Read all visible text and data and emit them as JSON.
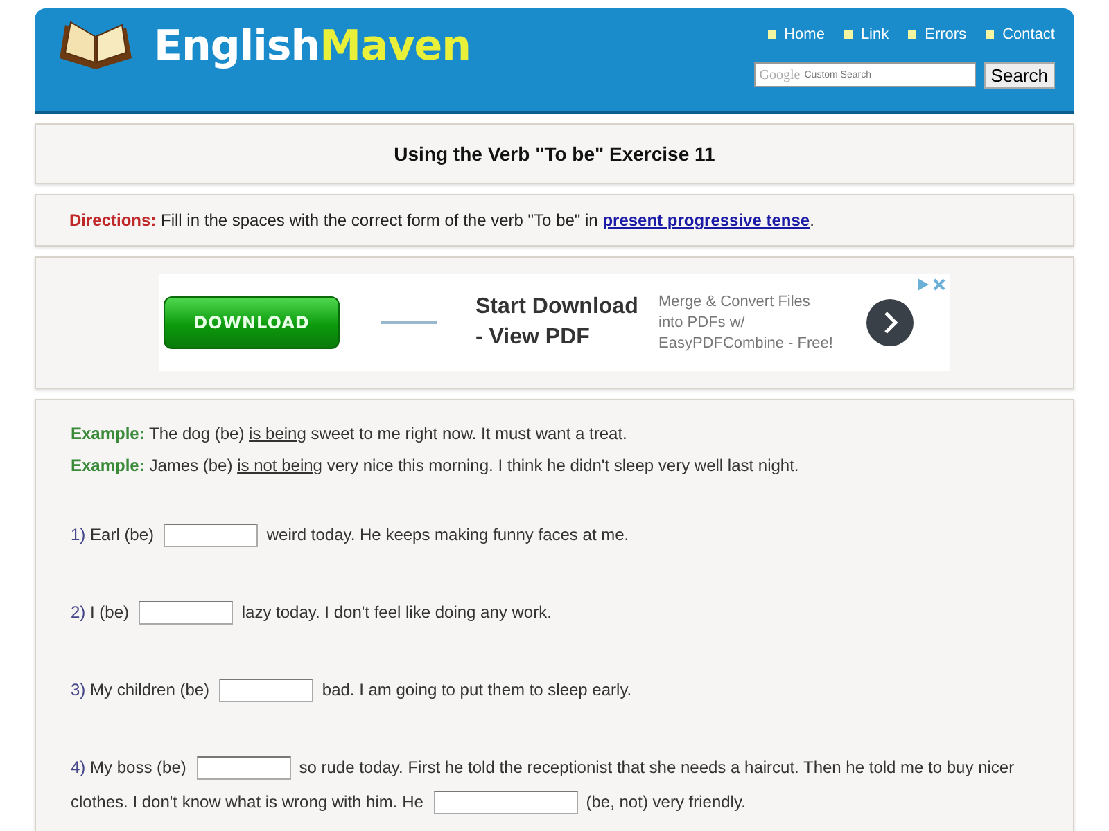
{
  "header": {
    "logo_first": "English",
    "logo_second": "Maven",
    "nav": [
      "Home",
      "Link",
      "Errors",
      "Contact"
    ],
    "search": {
      "placeholder": "Custom Search",
      "brand": "Google",
      "button": "Search"
    }
  },
  "title": "Using the Verb \"To be\" Exercise 11",
  "directions": {
    "label": "Directions:",
    "text": "Fill in the spaces with the correct form of the verb \"To be\" in",
    "link": "present progressive tense",
    "end": "."
  },
  "ad": {
    "button": "DOWNLOAD",
    "headline": "Start Download - View PDF",
    "body": "Merge & Convert Files into PDFs w/ EasyPDFCombine - Free!"
  },
  "examples": [
    {
      "label": "Example:",
      "before": "The dog (be)",
      "answer": "is being",
      "after": "sweet to me right now. It must want a treat."
    },
    {
      "label": "Example:",
      "before": "James (be)",
      "answer": "is not being",
      "after": "very nice this morning. I think he didn't sleep very well last night."
    }
  ],
  "questions": [
    {
      "number": "1)",
      "parts": [
        {
          "kind": "text",
          "text": "Earl (be)"
        },
        {
          "kind": "blank"
        },
        {
          "kind": "text",
          "text": "weird today. He keeps making funny faces at me."
        }
      ]
    },
    {
      "number": "2)",
      "parts": [
        {
          "kind": "text",
          "text": "I (be)"
        },
        {
          "kind": "blank"
        },
        {
          "kind": "text",
          "text": "lazy today. I don't feel like doing any work."
        }
      ]
    },
    {
      "number": "3)",
      "parts": [
        {
          "kind": "text",
          "text": "My children (be)"
        },
        {
          "kind": "blank"
        },
        {
          "kind": "text",
          "text": "bad. I am going to put them to sleep early."
        }
      ]
    },
    {
      "number": "4)",
      "parts": [
        {
          "kind": "text",
          "text": "My boss (be)"
        },
        {
          "kind": "blank"
        },
        {
          "kind": "text",
          "text": "so rude today. First he told the receptionist that she needs a haircut. Then he told me to buy nicer"
        },
        {
          "kind": "text",
          "text": "clothes. I don't know what is wrong with him. He"
        },
        {
          "kind": "wideblank"
        },
        {
          "kind": "text",
          "text": "(be, not) very friendly."
        }
      ]
    }
  ]
}
